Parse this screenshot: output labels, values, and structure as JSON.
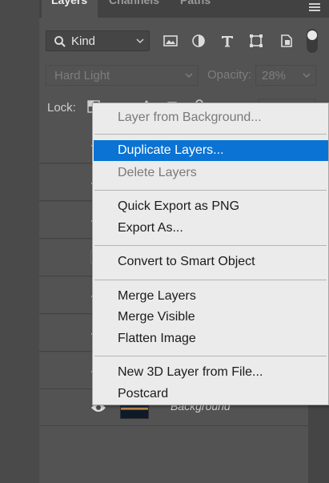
{
  "tabs": {
    "layers": "Layers",
    "channels": "Channels",
    "paths": "Paths"
  },
  "filter": {
    "kind_label": "Kind"
  },
  "blend": {
    "mode": "Hard Light",
    "opacity_label": "Opacity:",
    "opacity_value": "28%"
  },
  "lock": {
    "label": "Lock:"
  },
  "layers": [
    {
      "name": "",
      "visible": true
    },
    {
      "name": "",
      "visible": true
    },
    {
      "name": "",
      "visible": true
    },
    {
      "name": "",
      "visible": false
    },
    {
      "name": "",
      "visible": true
    },
    {
      "name": "",
      "visible": true
    },
    {
      "name": "",
      "visible": true
    },
    {
      "name": "Background",
      "visible": true,
      "locked": true
    }
  ],
  "context_menu": {
    "items": [
      {
        "label": "Layer from Background...",
        "enabled": true
      },
      {
        "label": "Duplicate Layers...",
        "enabled": true,
        "highlighted": true
      },
      {
        "label": "Delete Layers",
        "enabled": false
      },
      {
        "label": "Quick Export as PNG",
        "enabled": true
      },
      {
        "label": "Export As...",
        "enabled": true
      },
      {
        "label": "Convert to Smart Object",
        "enabled": true
      },
      {
        "label": "Merge Layers",
        "enabled": true
      },
      {
        "label": "Merge Visible",
        "enabled": true
      },
      {
        "label": "Flatten Image",
        "enabled": true
      },
      {
        "label": "New 3D Layer from File...",
        "enabled": true
      },
      {
        "label": "Postcard",
        "enabled": true
      }
    ]
  },
  "colors": {
    "panel_bg": "#535353",
    "menu_bg": "#ebebeb",
    "highlight": "#0a73d4"
  }
}
